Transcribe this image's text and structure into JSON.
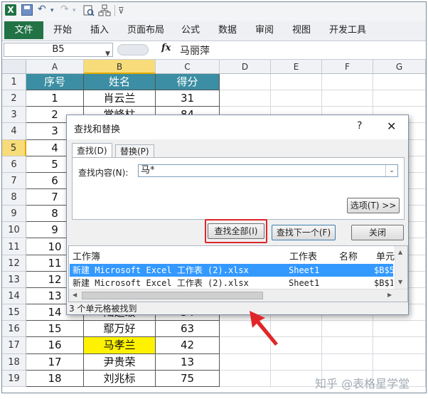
{
  "qat": {
    "excel_glyph": "X",
    "undo_glyph": "↶",
    "redo_glyph": "↷",
    "dropdown_glyph": "▾",
    "customize_glyph": "⊽"
  },
  "ribbon": {
    "file_tab": "文件",
    "tabs": [
      "开始",
      "插入",
      "页面布局",
      "公式",
      "数据",
      "审阅",
      "视图",
      "开发工具"
    ]
  },
  "formula_bar": {
    "name_box": "B5",
    "fx": "fx",
    "value": "马丽萍"
  },
  "grid": {
    "columns": [
      "A",
      "B",
      "C",
      "D",
      "E",
      "F",
      "G"
    ],
    "selected_column": "B",
    "selected_row": 5,
    "rows": [
      {
        "n": "1",
        "a": "序号",
        "b": "姓名",
        "c": "得分"
      },
      {
        "n": "2",
        "a": "1",
        "b": "肖云兰",
        "c": "31"
      },
      {
        "n": "3",
        "a": "2",
        "b": "常峰柱",
        "c": "84"
      },
      {
        "n": "4",
        "a": "3",
        "b": "",
        "c": ""
      },
      {
        "n": "5",
        "a": "4",
        "b": "",
        "c": ""
      },
      {
        "n": "6",
        "a": "5",
        "b": "",
        "c": ""
      },
      {
        "n": "7",
        "a": "6",
        "b": "",
        "c": ""
      },
      {
        "n": "8",
        "a": "7",
        "b": "",
        "c": ""
      },
      {
        "n": "9",
        "a": "8",
        "b": "",
        "c": ""
      },
      {
        "n": "10",
        "a": "9",
        "b": "",
        "c": ""
      },
      {
        "n": "11",
        "a": "10",
        "b": "",
        "c": ""
      },
      {
        "n": "12",
        "a": "11",
        "b": "",
        "c": ""
      },
      {
        "n": "13",
        "a": "12",
        "b": "",
        "c": ""
      },
      {
        "n": "14",
        "a": "13",
        "b": "",
        "c": ""
      },
      {
        "n": "15",
        "a": "14",
        "b": "陆迅级",
        "c": "34"
      },
      {
        "n": "16",
        "a": "15",
        "b": "鄢万好",
        "c": "63"
      },
      {
        "n": "17",
        "a": "16",
        "b": "马孝兰",
        "c": "42"
      },
      {
        "n": "18",
        "a": "17",
        "b": "尹贵荣",
        "c": "13"
      },
      {
        "n": "19",
        "a": "18",
        "b": "刘兆标",
        "c": "75"
      }
    ]
  },
  "dialog": {
    "title": "查找和替换",
    "help": "?",
    "close": "✕",
    "tab_find": "查找(D)",
    "tab_replace": "替换(P)",
    "find_label": "查找内容(N):",
    "find_value": "马*",
    "dropdown_glyph": "⌄",
    "options_button": "选项(T) >>",
    "find_all_button": "查找全部(I)",
    "find_next_button": "查找下一个(F)",
    "close_button": "关闭",
    "result_headers": [
      "工作簿",
      "工作表",
      "名称",
      "单元"
    ],
    "result_rows": [
      {
        "book": "新建 Microsoft Excel 工作表 (2).xlsx",
        "sheet": "Sheet1",
        "cell": "$B$5"
      },
      {
        "book": "新建 Microsoft Excel 工作表 (2).xlsx",
        "sheet": "Sheet1",
        "cell": "$B$1"
      }
    ],
    "status": "3 个单元格被找到"
  },
  "watermark": "知乎 @表格星学堂",
  "colors": {
    "header_fill": "#3b8ea3",
    "highlight_yellow": "#fff200",
    "annotation_red": "#e0262a",
    "selection_blue": "#3399ff"
  }
}
